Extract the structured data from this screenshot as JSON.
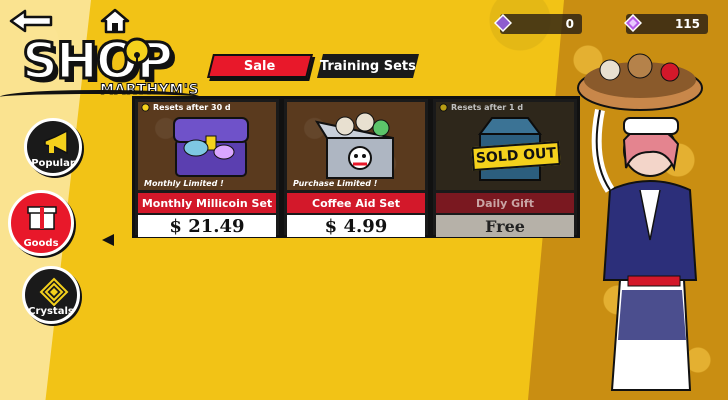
{
  "header": {
    "shop_title": "SHOP",
    "shop_subtitle": "MARTHYM'S"
  },
  "tabs": [
    {
      "label": "Sale",
      "active": true
    },
    {
      "label": "Training Sets",
      "active": false
    }
  ],
  "currency": [
    {
      "icon": "purple-crystal-icon",
      "value": "0"
    },
    {
      "icon": "gem-icon",
      "value": "115"
    }
  ],
  "sidenav": [
    {
      "label": "Popular",
      "icon": "megaphone-icon",
      "active": false
    },
    {
      "label": "Goods",
      "icon": "gift-box-icon",
      "active": true
    },
    {
      "label": "Crystals",
      "icon": "crystal-icon",
      "active": false
    }
  ],
  "cards": [
    {
      "reset": "Resets after  30 d",
      "limit": "Monthly Limited !",
      "name": "Monthly Millicoin Set",
      "price": "$ 21.49",
      "sold_out": false
    },
    {
      "reset": "",
      "limit": "Purchase Limited !",
      "name": "Coffee Aid Set",
      "price": "$ 4.99",
      "sold_out": false
    },
    {
      "reset": "Resets after  1 d",
      "limit": "",
      "name": "Daily Gift",
      "price": "Free",
      "sold_out": true,
      "sold_out_label": "SOLD OUT"
    }
  ],
  "colors": {
    "background": "#f2c316",
    "accent_red": "#e8182a",
    "dark": "#1a1a1a"
  }
}
